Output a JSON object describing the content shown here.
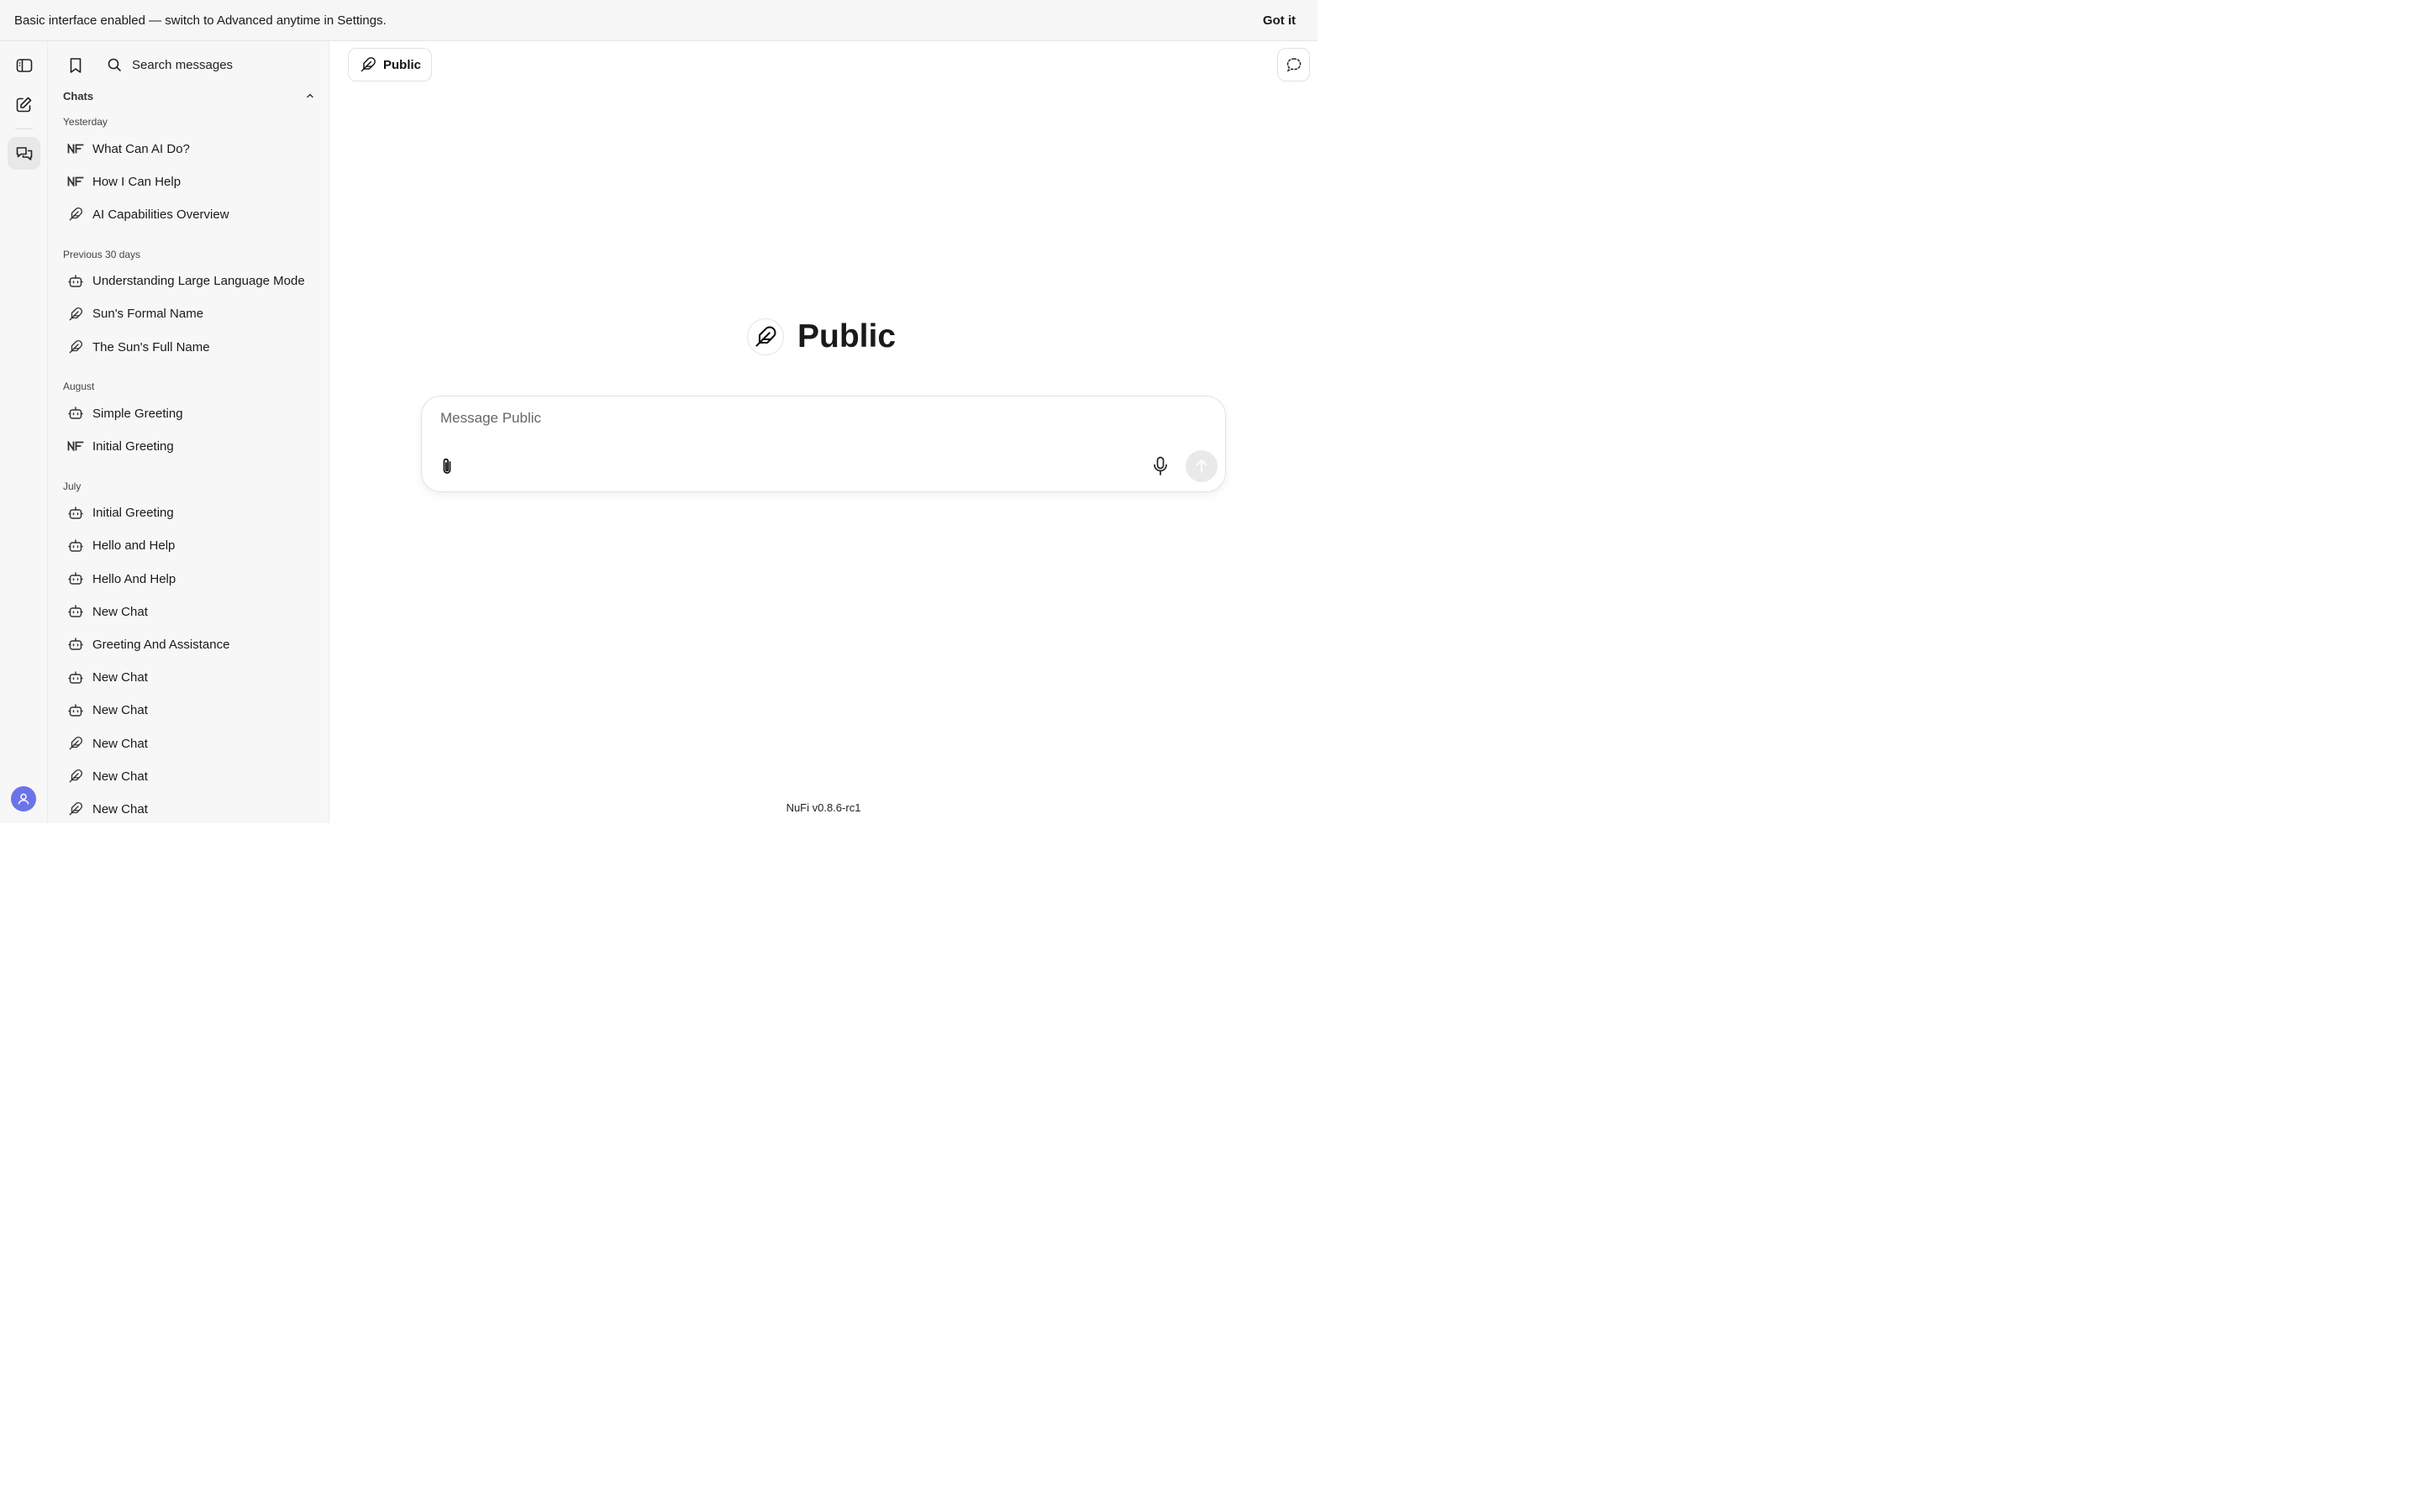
{
  "banner": {
    "message": "Basic interface enabled — switch to Advanced anytime in Settings.",
    "dismiss_label": "Got it"
  },
  "rail": {
    "items": [
      {
        "name": "toggle-sidebar",
        "icon": "sidebar-icon"
      },
      {
        "name": "new-chat",
        "icon": "pencil-square-icon"
      },
      {
        "name": "chats",
        "icon": "chat-bubbles-icon",
        "active": true
      }
    ],
    "avatar_color": "#6b73e8"
  },
  "sidebar": {
    "search": {
      "placeholder": "Search messages"
    },
    "section_title": "Chats",
    "groups": [
      {
        "label": "Yesterday",
        "items": [
          {
            "title": "What Can AI Do?",
            "icon": "nf-logo-icon"
          },
          {
            "title": "How I Can Help",
            "icon": "nf-logo-icon"
          },
          {
            "title": "AI Capabilities Overview",
            "icon": "feather-icon"
          }
        ]
      },
      {
        "label": "Previous 30 days",
        "items": [
          {
            "title": "Understanding Large Language Models",
            "icon": "robot-icon"
          },
          {
            "title": "Sun's Formal Name",
            "icon": "feather-icon"
          },
          {
            "title": "The Sun's Full Name",
            "icon": "feather-icon"
          }
        ]
      },
      {
        "label": "August",
        "items": [
          {
            "title": "Simple Greeting",
            "icon": "robot-icon"
          },
          {
            "title": "Initial Greeting",
            "icon": "nf-logo-icon"
          }
        ]
      },
      {
        "label": "July",
        "items": [
          {
            "title": "Initial Greeting",
            "icon": "robot-icon"
          },
          {
            "title": "Hello and Help",
            "icon": "robot-icon"
          },
          {
            "title": "Hello And Help",
            "icon": "robot-icon"
          },
          {
            "title": "New Chat",
            "icon": "robot-icon"
          },
          {
            "title": "Greeting And Assistance",
            "icon": "robot-icon"
          },
          {
            "title": "New Chat",
            "icon": "robot-icon"
          },
          {
            "title": "New Chat",
            "icon": "robot-icon"
          },
          {
            "title": "New Chat",
            "icon": "feather-icon"
          },
          {
            "title": "New Chat",
            "icon": "feather-icon"
          },
          {
            "title": "New Chat",
            "icon": "feather-icon"
          }
        ]
      }
    ]
  },
  "main": {
    "model_selector": {
      "label": "Public",
      "icon": "feather-icon"
    },
    "hero": {
      "title": "Public",
      "icon": "feather-icon"
    },
    "composer": {
      "placeholder": "Message Public"
    },
    "version": "NuFi v0.8.6-rc1"
  }
}
